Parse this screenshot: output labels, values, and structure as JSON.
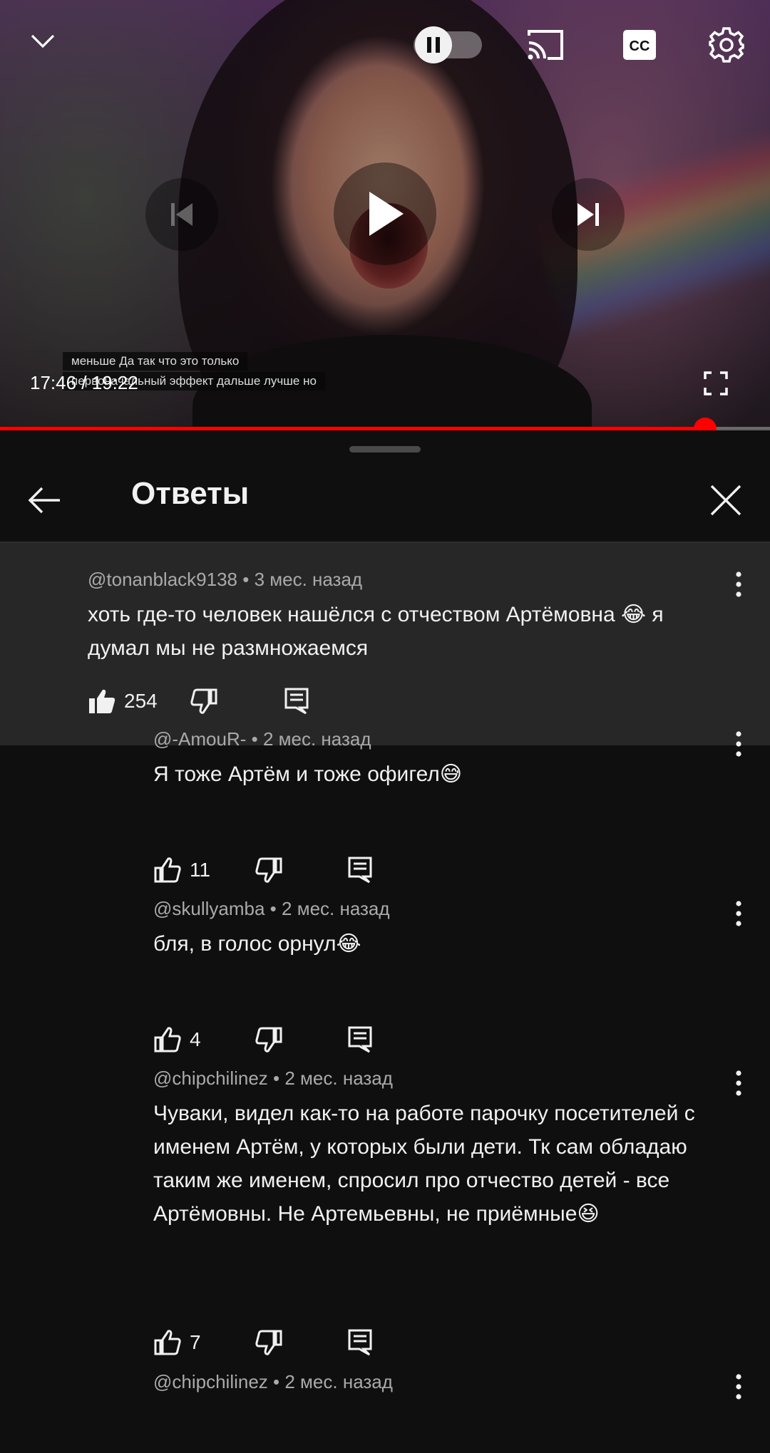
{
  "player": {
    "time_current": "17:46",
    "time_separator": " / ",
    "time_total": "19:22",
    "progress_fraction": 0.916,
    "caption_line1": "меньше Да так что это только",
    "caption_line2": "первоначальный эффект дальше лучше но",
    "autoplay": "on",
    "state": "paused",
    "icons": [
      "chevron-down-icon",
      "autoplay-toggle",
      "cast-icon",
      "cc-icon",
      "settings-icon",
      "previous-icon",
      "play-icon",
      "next-icon",
      "fullscreen-icon"
    ]
  },
  "panel": {
    "title": "Ответы"
  },
  "parent_comment": {
    "author": "@tonanblack9138",
    "time": "3 мес. назад",
    "text": "хоть где-то человек нашёлся с отчеством Артёмовна 😂 я думал мы не размножаемся",
    "likes": "254",
    "liked": true
  },
  "replies": [
    {
      "author": "@-AmouR-",
      "time": "2 мес. назад",
      "text": "Я тоже Артём и тоже офигел😅",
      "likes": "11"
    },
    {
      "author": "@skullyamba",
      "time": "2 мес. назад",
      "text": "бля, в голос орнул😂",
      "likes": "4"
    },
    {
      "author": "@chipchilinez",
      "time": "2 мес. назад",
      "text": "Чуваки, видел как-то на работе парочку посетителей с именем Артём, у которых были дети. Тк сам обладаю таким же именем, спросил про отчество детей - все Артёмовны. Не Артемьевны, не приёмные😆",
      "likes": "7"
    },
    {
      "author": "@chipchilinez",
      "time": "2 мес. назад",
      "text": "",
      "likes": ""
    }
  ],
  "meta_separator": " • ",
  "colors": {
    "accent": "#ff0000",
    "background": "#0f0f0f",
    "parent_bg": "#272727",
    "secondary_text": "#aaaaaa"
  }
}
